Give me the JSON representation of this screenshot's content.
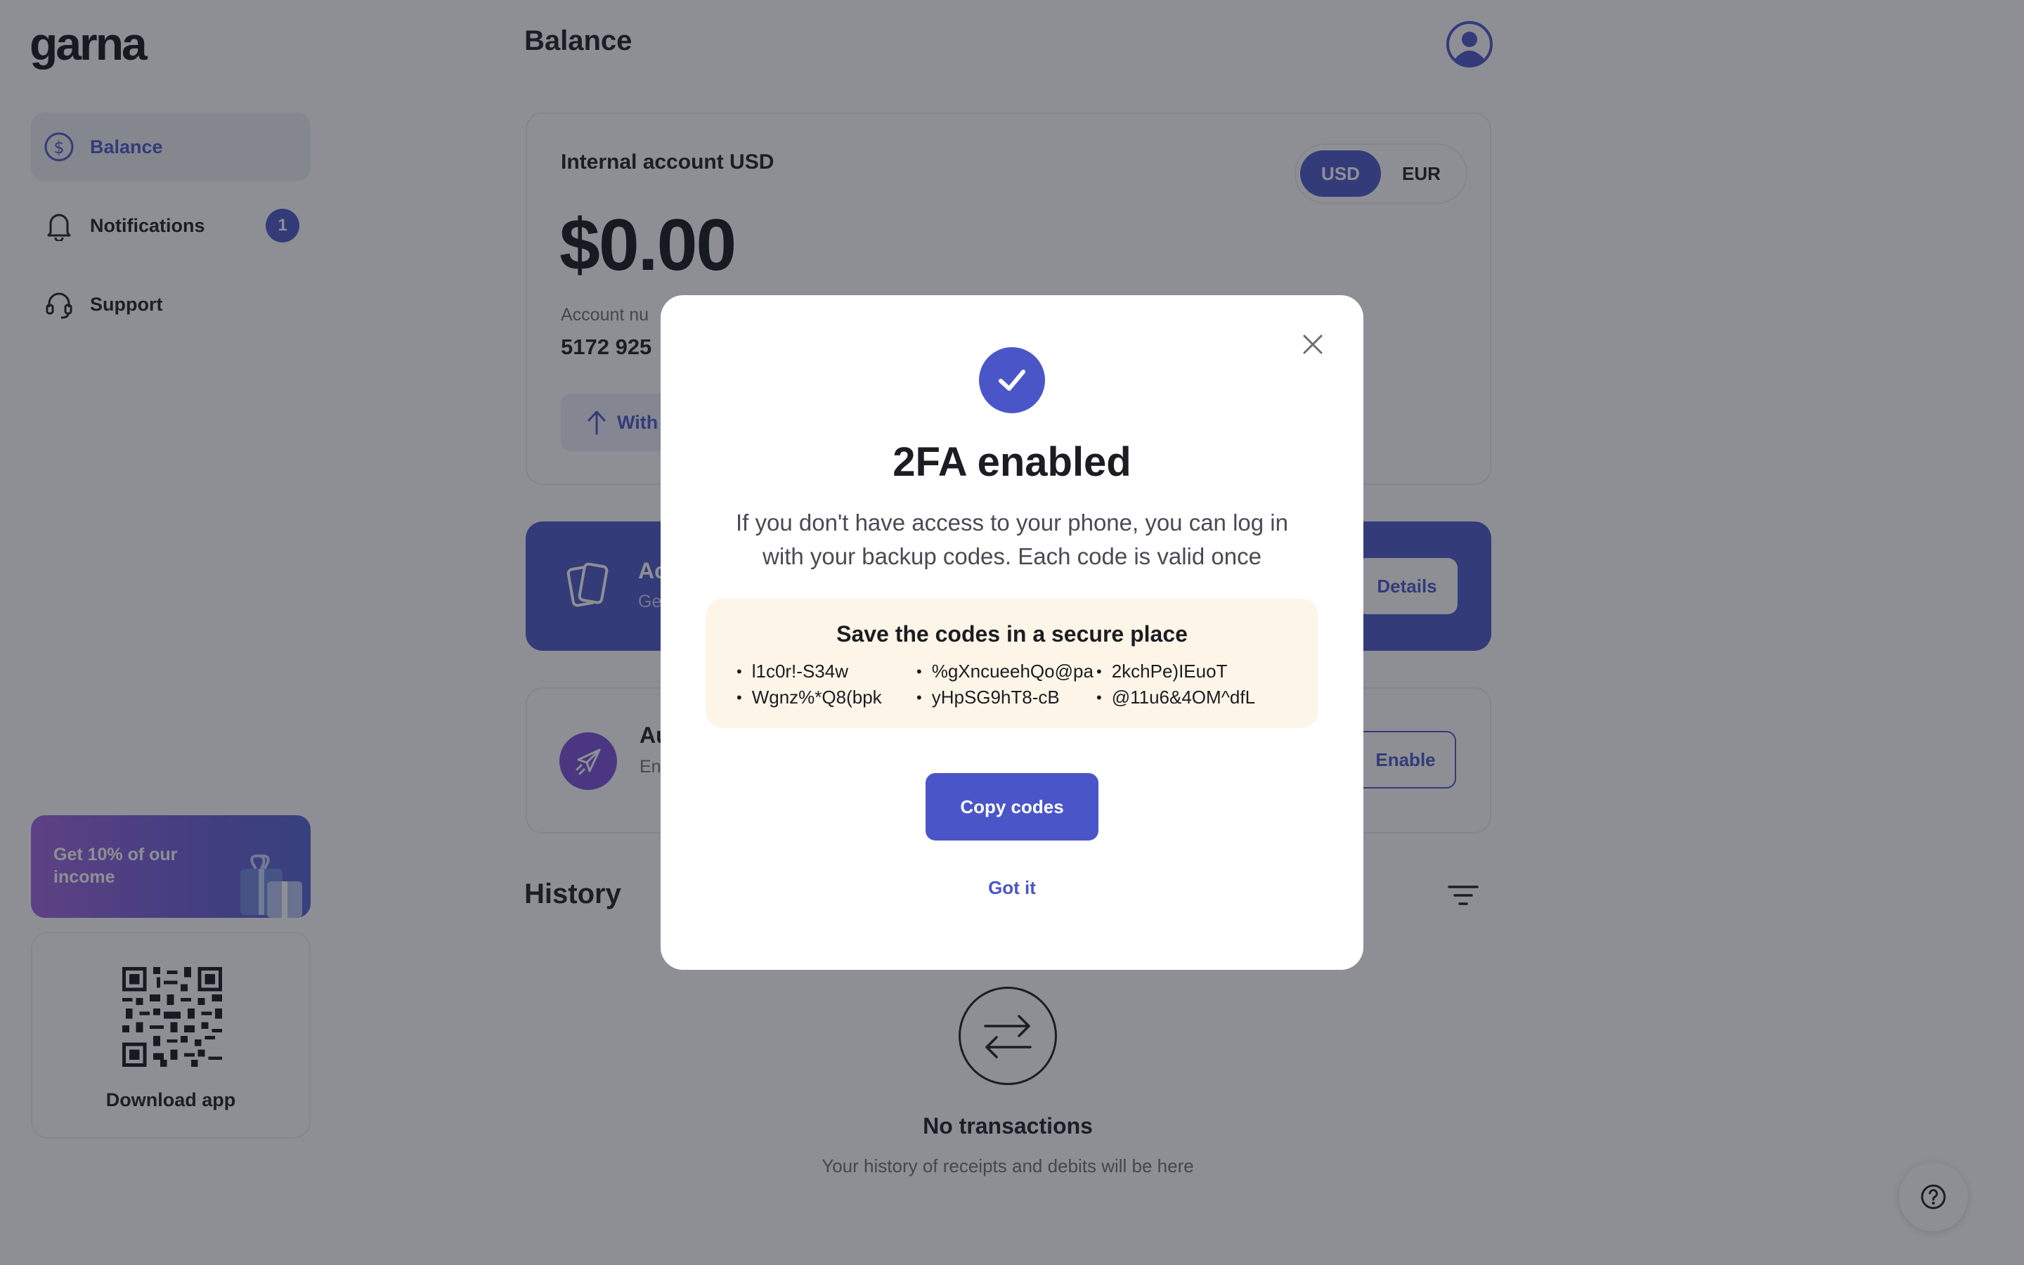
{
  "app": {
    "logo": "garna"
  },
  "sidebar": {
    "items": [
      {
        "label": "Balance",
        "icon": "dollar-circle-icon",
        "active": true
      },
      {
        "label": "Notifications",
        "icon": "bell-icon",
        "badge": "1"
      },
      {
        "label": "Support",
        "icon": "headset-icon"
      }
    ],
    "promo": {
      "text": "Get 10% of our income",
      "icon": "gift-icon"
    },
    "download": {
      "label": "Download app",
      "icon": "qr-code-icon"
    }
  },
  "header": {
    "title": "Balance",
    "avatar_icon": "user-avatar-icon"
  },
  "balance_card": {
    "title": "Internal account USD",
    "currencies": [
      "USD",
      "EUR"
    ],
    "selected_currency": "USD",
    "amount": "$0.00",
    "account_number_label": "Account nu",
    "account_number": "5172 925",
    "withdraw_label": "With"
  },
  "accounts_card": {
    "title": "Ac",
    "subtitle": "Ge",
    "button": "Details"
  },
  "auto_card": {
    "title": "Au",
    "subtitle": "En ful",
    "button": "Enable"
  },
  "history": {
    "title": "History",
    "empty_title": "No transactions",
    "empty_subtitle": "Your history of receipts and debits will be here"
  },
  "modal": {
    "title": "2FA enabled",
    "description": "If you don't have access to your phone, you can log in with your backup codes. Each code is valid once",
    "codes_title": "Save the codes in a secure place",
    "codes": [
      "l1c0r!-S34w",
      "%gXncueehQo@pa",
      "2kchPe)IEuoT",
      "Wgnz%*Q8(bpk",
      "yHpSG9hT8-cB",
      "@11u6&4OM^dfL"
    ],
    "copy_button": "Copy codes",
    "got_it_button": "Got it"
  },
  "colors": {
    "accent": "#4a56c8",
    "codes_bg": "#fdf6e8",
    "overlay": "rgba(28,32,42,0.5)"
  }
}
